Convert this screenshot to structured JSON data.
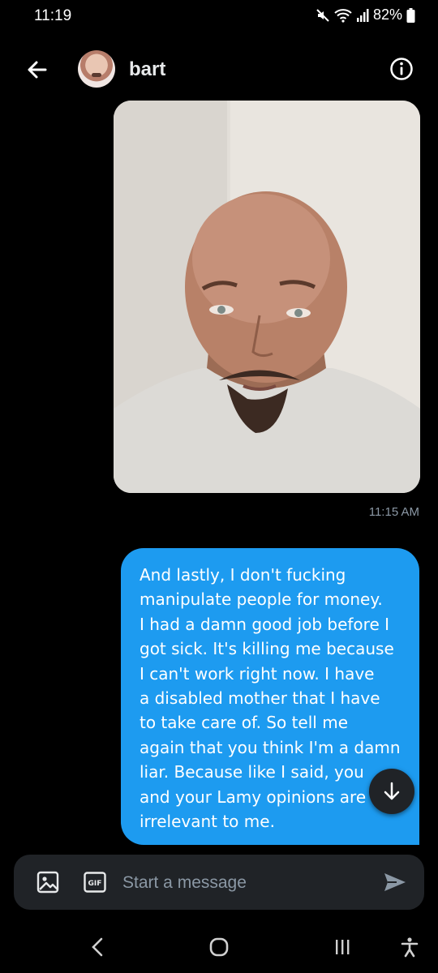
{
  "status_bar": {
    "time": "11:19",
    "battery": "82%",
    "icons": [
      "mute-icon",
      "wifi-icon",
      "signal-icon",
      "battery-icon"
    ]
  },
  "header": {
    "name": "bart",
    "back_icon": "arrow-left-icon",
    "info_icon": "info-icon"
  },
  "conversation": {
    "image_message": {
      "alt": "Selfie of a bald man with a goatee",
      "time": "11:15 AM"
    },
    "text_message": {
      "text": "And lastly,  I don't fucking\nmanipulate people for money.\nI had a damn good job before I\ngot sick. It's killing me because\nI can't work right now. I have\na disabled mother that I have\nto take care of.  So tell me\nagain that you think I'm a damn\nliar. Because like I said,  you\nand your Lamy opinions are\nirrelevant to me."
    }
  },
  "composer": {
    "placeholder": "Start a message",
    "gif_label": "GIF"
  },
  "colors": {
    "background": "#000000",
    "bubble": "#1d9bf0",
    "composer": "#202327",
    "muted_text": "#8b98a5"
  }
}
